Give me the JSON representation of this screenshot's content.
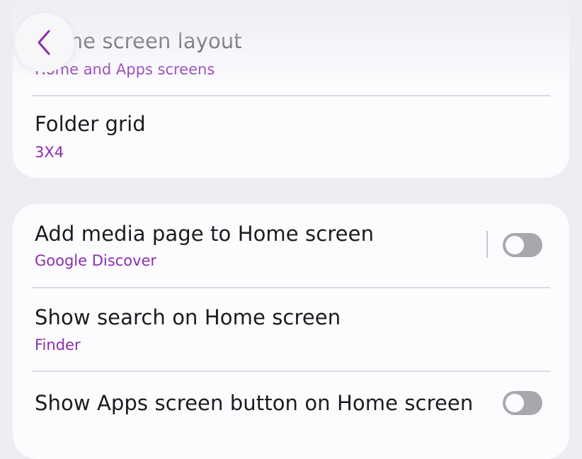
{
  "header": {
    "title": "Home screen layout",
    "back_icon": "chevron-left-icon"
  },
  "group1": {
    "items": [
      {
        "label": "Home screen layout",
        "value": "Home and Apps screens"
      },
      {
        "label": "Folder grid",
        "value": "3X4"
      }
    ]
  },
  "group2": {
    "items": [
      {
        "label": "Add media page to Home screen",
        "value": "Google Discover",
        "toggle": false
      },
      {
        "label": "Show search on Home screen",
        "value": "Finder"
      },
      {
        "label": "Show Apps screen button on Home screen",
        "toggle": false
      }
    ]
  },
  "colors": {
    "accent": "#8a2fae",
    "background": "#eeedf4",
    "card": "#fcfbfd",
    "toggle_off": "#a8a7ad"
  }
}
